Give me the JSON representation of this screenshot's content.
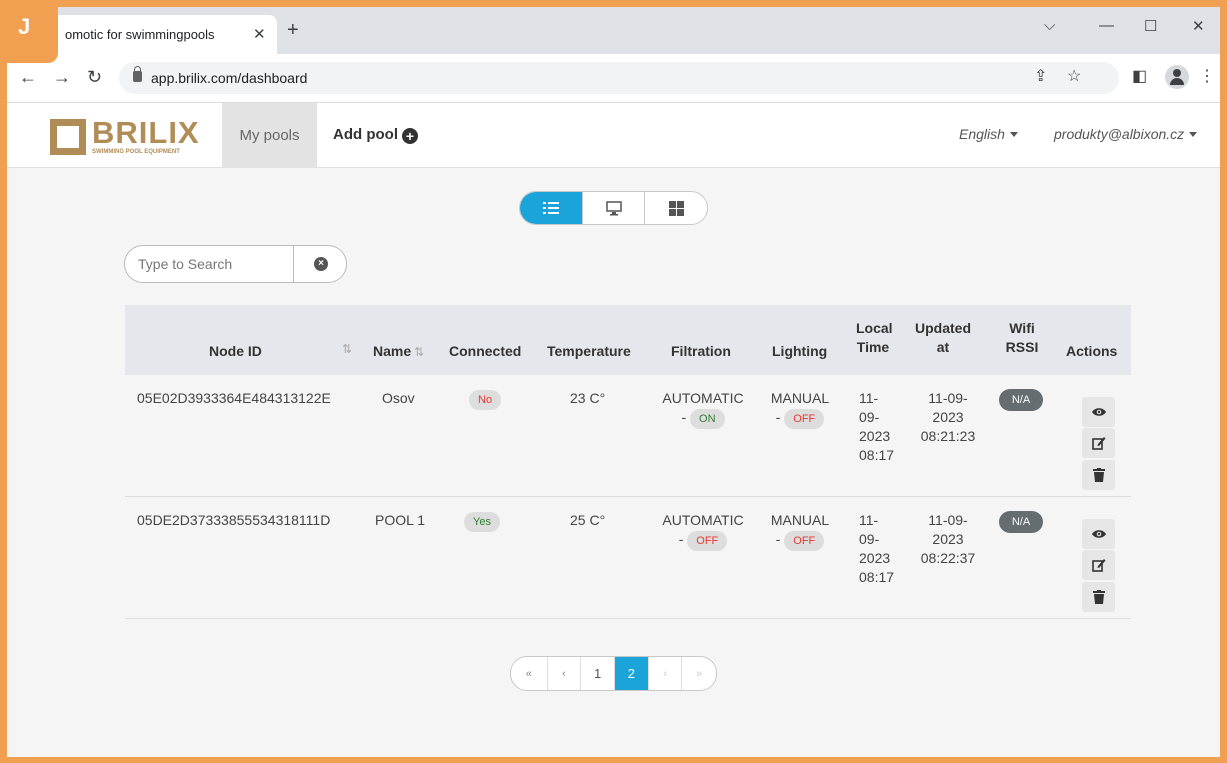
{
  "browser": {
    "tab_title": "Domotic for swimmingpools",
    "tab_visible_title": "omotic for swimmingpools",
    "url": "app.brilix.com/dashboard",
    "badge": "J"
  },
  "nav": {
    "logo_word": "BRILIX",
    "logo_sub": "SWIMMING POOL EQUIPMENT",
    "my_pools": "My pools",
    "add_pool": "Add pool",
    "language": "English",
    "user": "produkty@albixon.cz"
  },
  "search": {
    "placeholder": "Type to Search"
  },
  "table": {
    "headers": {
      "node_id": "Node ID",
      "name": "Name",
      "connected": "Connected",
      "temperature": "Temperature",
      "filtration": "Filtration",
      "lighting": "Lighting",
      "local_time_1": "Local",
      "local_time_2": "Time",
      "updated_1": "Updated",
      "updated_2": "at",
      "wifi_1": "Wifi",
      "wifi_2": "RSSI",
      "actions": "Actions"
    },
    "rows": [
      {
        "node_id": "05E02D3933364E484313122E",
        "name": "Osov",
        "connected": "No",
        "temperature": "23 C°",
        "filtration_mode": "AUTOMATIC",
        "filtration_state": "ON",
        "lighting_mode": "MANUAL",
        "lighting_state": "OFF",
        "local_time": [
          "11-",
          "09-",
          "2023",
          "08:17"
        ],
        "updated_at": [
          "11-09-",
          "2023",
          "08:21:23"
        ],
        "wifi": "N/A"
      },
      {
        "node_id": "05DE2D37333855534318111D",
        "name": "POOL 1",
        "connected": "Yes",
        "temperature": "25 C°",
        "filtration_mode": "AUTOMATIC",
        "filtration_state": "OFF",
        "lighting_mode": "MANUAL",
        "lighting_state": "OFF",
        "local_time": [
          "11-",
          "09-",
          "2023",
          "08:17"
        ],
        "updated_at": [
          "11-09-",
          "2023",
          "08:22:37"
        ],
        "wifi": "N/A"
      }
    ]
  },
  "pagination": {
    "first": "«",
    "prev": "‹",
    "pages": [
      "1",
      "2"
    ],
    "current": "2",
    "next": "›",
    "last": "»"
  },
  "colors": {
    "accent": "#1aa4d9",
    "brand": "#b08d57",
    "frame": "#f0a050"
  }
}
